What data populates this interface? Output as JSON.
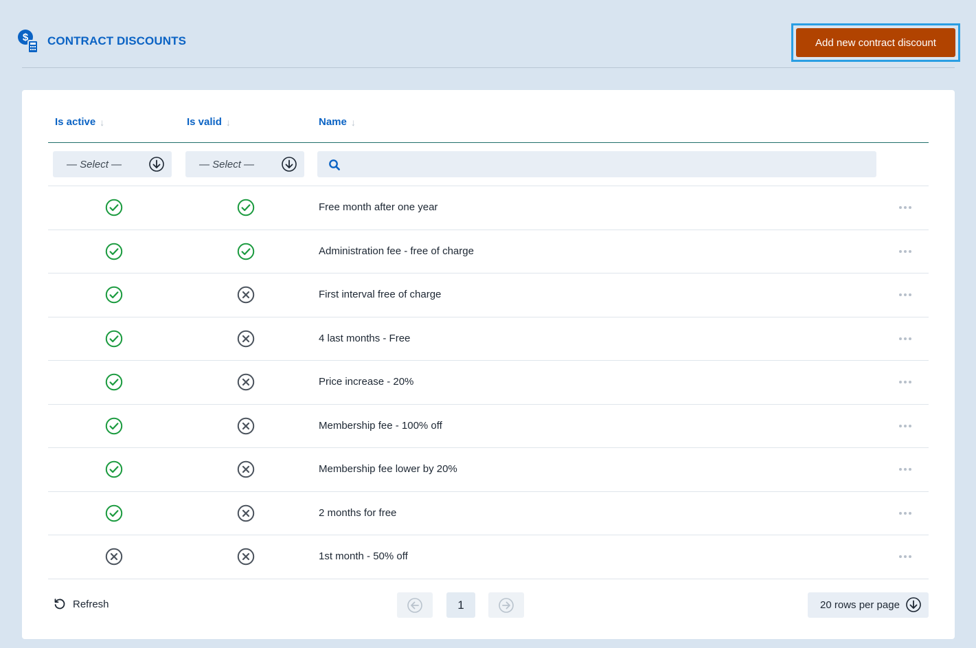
{
  "header": {
    "title": "CONTRACT DISCOUNTS",
    "add_button": "Add new contract discount"
  },
  "table": {
    "columns": [
      {
        "label": "Is active"
      },
      {
        "label": "Is valid"
      },
      {
        "label": "Name"
      }
    ],
    "filters": {
      "active_select": "— Select —",
      "valid_select": "— Select —",
      "search_placeholder": ""
    },
    "rows": [
      {
        "active": true,
        "valid": true,
        "name": "Free month after one year"
      },
      {
        "active": true,
        "valid": true,
        "name": "Administration fee - free of charge"
      },
      {
        "active": true,
        "valid": false,
        "name": "First interval free of charge"
      },
      {
        "active": true,
        "valid": false,
        "name": "4 last months - Free"
      },
      {
        "active": true,
        "valid": false,
        "name": "Price increase - 20%"
      },
      {
        "active": true,
        "valid": false,
        "name": "Membership fee - 100% off"
      },
      {
        "active": true,
        "valid": false,
        "name": "Membership fee lower by 20%"
      },
      {
        "active": true,
        "valid": false,
        "name": "2 months for free"
      },
      {
        "active": false,
        "valid": false,
        "name": "1st month - 50% off"
      }
    ]
  },
  "footer": {
    "refresh": "Refresh",
    "page": "1",
    "rows_per_page": "20 rows per page"
  },
  "colors": {
    "accent": "#0b63c4",
    "button": "#b14300",
    "check": "#1a9a3e",
    "cross": "#4a525c"
  }
}
